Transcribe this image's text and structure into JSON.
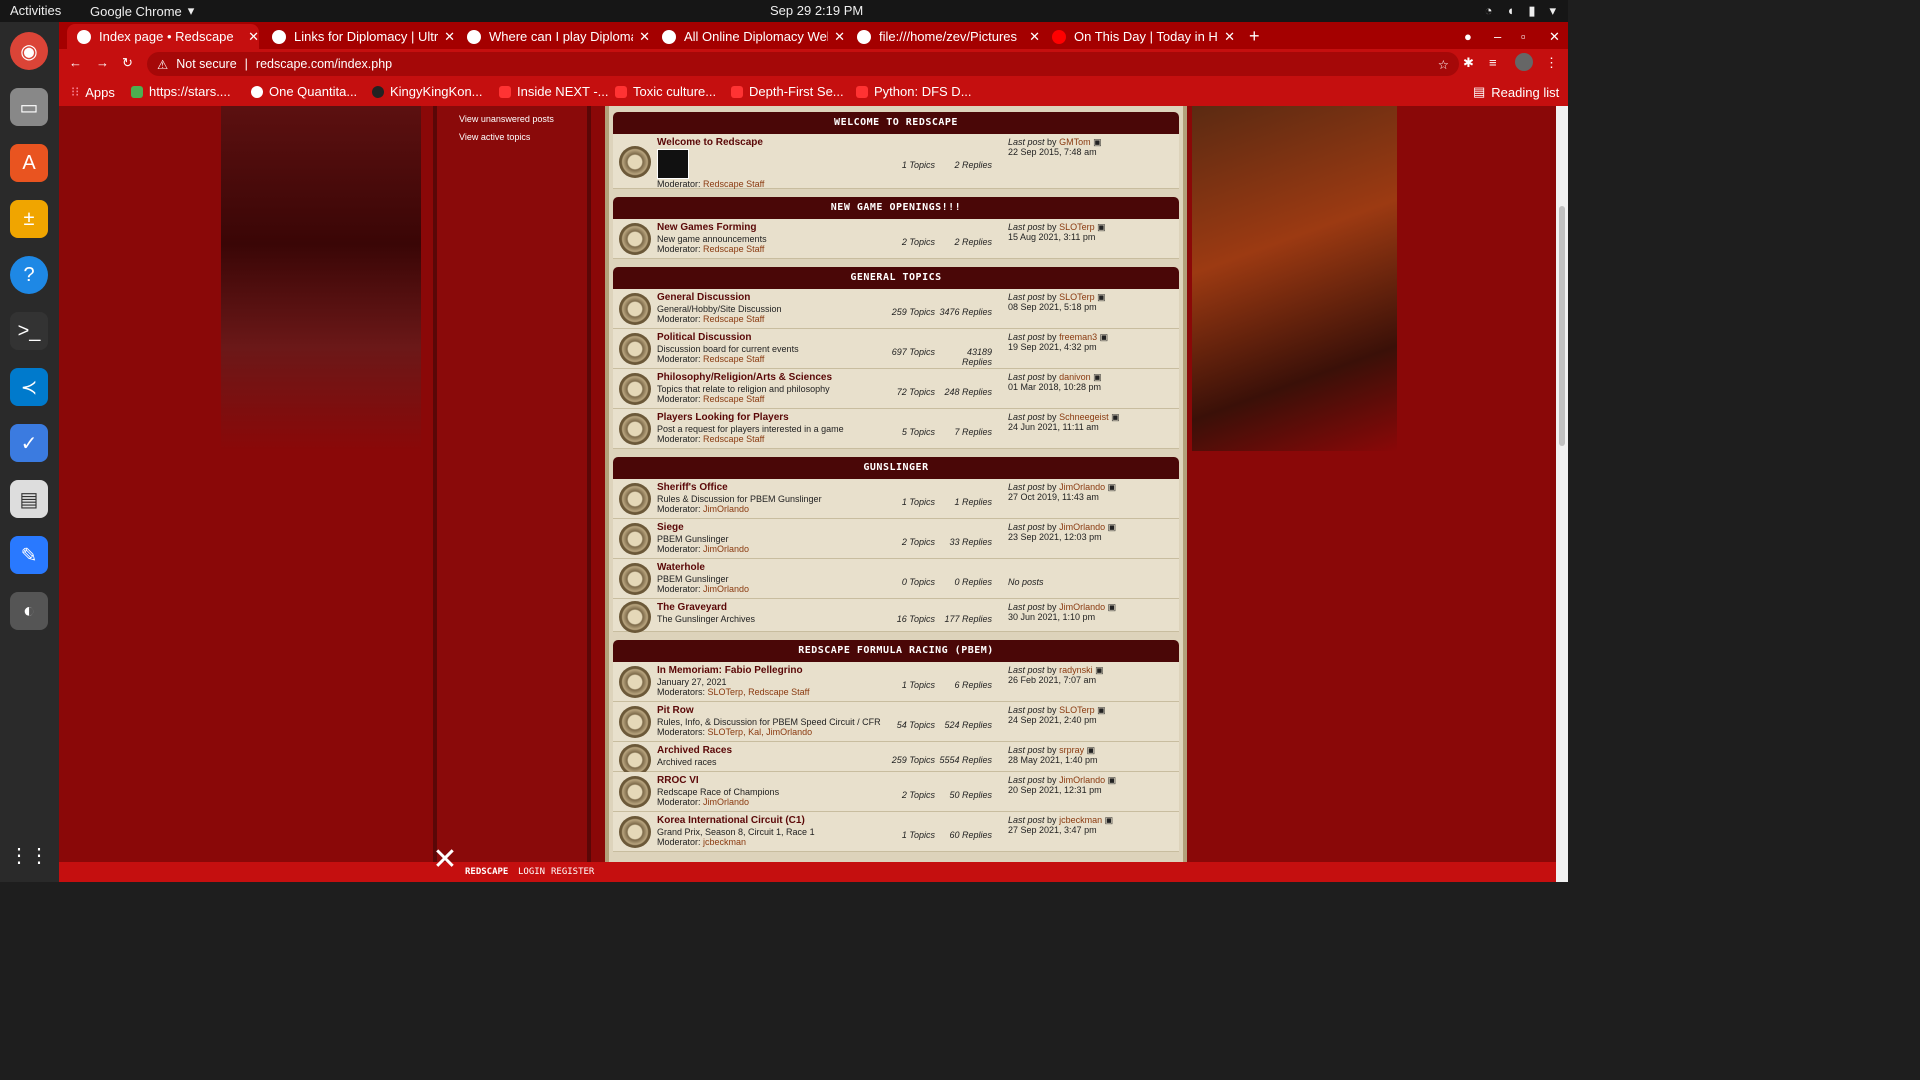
{
  "system": {
    "activities": "Activities",
    "app_name": "Google Chrome",
    "clock": "Sep 29  2:19 PM"
  },
  "tabs": [
    {
      "title": "Index page • Redscape"
    },
    {
      "title": "Links for Diplomacy | Ultr"
    },
    {
      "title": "Where can I play Diploma"
    },
    {
      "title": "All Online Diplomacy Web"
    },
    {
      "title": "file:///home/zev/Pictures"
    },
    {
      "title": "On This Day | Today in His"
    }
  ],
  "omnibox": {
    "security": "Not secure",
    "url": "redscape.com/index.php"
  },
  "bookmarks": {
    "apps": "Apps",
    "items": [
      "https://stars....",
      "One Quantita...",
      "KingyKingKon...",
      "Inside NEXT -...",
      "Toxic culture...",
      "Depth-First Se...",
      "Python: DFS D..."
    ],
    "reading_list": "Reading list"
  },
  "sidebar": {
    "links": [
      "View unanswered posts",
      "View active topics"
    ]
  },
  "categories": [
    {
      "title": "WELCOME TO REDSCAPE",
      "forums": [
        {
          "name": "Welcome to Redscape",
          "desc": "",
          "mod_label": "Moderator:",
          "mods": "Redscape Staff",
          "topics": "1 Topics",
          "replies": "2 Replies",
          "last_label": "Last post",
          "by": "by",
          "last_user": "GMTom",
          "last_date": "22 Sep 2015, 7:48 am"
        }
      ]
    },
    {
      "title": "NEW GAME OPENINGS!!!",
      "forums": [
        {
          "name": "New Games Forming",
          "desc": "New game announcements",
          "mod_label": "Moderator:",
          "mods": "Redscape Staff",
          "topics": "2 Topics",
          "replies": "2 Replies",
          "last_label": "Last post",
          "by": "by",
          "last_user": "SLOTerp",
          "last_date": "15 Aug 2021, 3:11 pm"
        }
      ]
    },
    {
      "title": "GENERAL TOPICS",
      "forums": [
        {
          "name": "General Discussion",
          "desc": "General/Hobby/Site Discussion",
          "mod_label": "Moderator:",
          "mods": "Redscape Staff",
          "topics": "259 Topics",
          "replies": "3476 Replies",
          "last_label": "Last post",
          "by": "by",
          "last_user": "SLOTerp",
          "last_date": "08 Sep 2021, 5:18 pm"
        },
        {
          "name": "Political Discussion",
          "desc": "Discussion board for current events",
          "mod_label": "Moderator:",
          "mods": "Redscape Staff",
          "topics": "697 Topics",
          "replies": "43189 Replies",
          "last_label": "Last post",
          "by": "by",
          "last_user": "freeman3",
          "last_date": "19 Sep 2021, 4:32 pm"
        },
        {
          "name": "Philosophy/Religion/Arts & Sciences",
          "desc": "Topics that relate to religion and philosophy",
          "mod_label": "Moderator:",
          "mods": "Redscape Staff",
          "topics": "72 Topics",
          "replies": "248 Replies",
          "last_label": "Last post",
          "by": "by",
          "last_user": "danivon",
          "last_date": "01 Mar 2018, 10:28 pm"
        },
        {
          "name": "Players Looking for Players",
          "desc": "Post a request for players interested in a game",
          "mod_label": "Moderator:",
          "mods": "Redscape Staff",
          "topics": "5 Topics",
          "replies": "7 Replies",
          "last_label": "Last post",
          "by": "by",
          "last_user": "Schneegeist",
          "last_date": "24 Jun 2021, 11:11 am"
        }
      ]
    },
    {
      "title": "GUNSLINGER",
      "forums": [
        {
          "name": "Sheriff's Office",
          "desc": "Rules & Discussion for PBEM Gunslinger",
          "mod_label": "Moderator:",
          "mods": "JimOrlando",
          "topics": "1 Topics",
          "replies": "1 Replies",
          "last_label": "Last post",
          "by": "by",
          "last_user": "JimOrlando",
          "last_date": "27 Oct 2019, 11:43 am"
        },
        {
          "name": "Siege",
          "desc": "PBEM Gunslinger",
          "mod_label": "Moderator:",
          "mods": "JimOrlando",
          "topics": "2 Topics",
          "replies": "33 Replies",
          "last_label": "Last post",
          "by": "by",
          "last_user": "JimOrlando",
          "last_date": "23 Sep 2021, 12:03 pm"
        },
        {
          "name": "Waterhole",
          "desc": "PBEM Gunslinger",
          "mod_label": "Moderator:",
          "mods": "JimOrlando",
          "topics": "0 Topics",
          "replies": "0 Replies",
          "last_label": "No posts",
          "by": "",
          "last_user": "",
          "last_date": ""
        },
        {
          "name": "The Graveyard",
          "desc": "The Gunslinger Archives",
          "mod_label": "",
          "mods": "",
          "topics": "16 Topics",
          "replies": "177 Replies",
          "last_label": "Last post",
          "by": "by",
          "last_user": "JimOrlando",
          "last_date": "30 Jun 2021, 1:10 pm"
        }
      ]
    },
    {
      "title": "REDSCAPE FORMULA RACING (PBEM)",
      "forums": [
        {
          "name": "In Memoriam: Fabio Pellegrino",
          "desc": "January 27, 2021",
          "mod_label": "Moderators:",
          "mods": "SLOTerp, Redscape Staff",
          "topics": "1 Topics",
          "replies": "6 Replies",
          "last_label": "Last post",
          "by": "by",
          "last_user": "radynski",
          "last_date": "26 Feb 2021, 7:07 am"
        },
        {
          "name": "Pit Row",
          "desc": "Rules, Info, & Discussion for PBEM Speed Circuit / CFR",
          "mod_label": "Moderators:",
          "mods": "SLOTerp, Kal, JimOrlando",
          "topics": "54 Topics",
          "replies": "524 Replies",
          "last_label": "Last post",
          "by": "by",
          "last_user": "SLOTerp",
          "last_date": "24 Sep 2021, 2:40 pm"
        },
        {
          "name": "Archived Races",
          "desc": "Archived races",
          "mod_label": "",
          "mods": "",
          "topics": "259 Topics",
          "replies": "5554 Replies",
          "last_label": "Last post",
          "by": "by",
          "last_user": "srpray",
          "last_date": "28 May 2021, 1:40 pm"
        },
        {
          "name": "RROC VI",
          "desc": "Redscape Race of Champions",
          "mod_label": "Moderator:",
          "mods": "JimOrlando",
          "topics": "2 Topics",
          "replies": "50 Replies",
          "last_label": "Last post",
          "by": "by",
          "last_user": "JimOrlando",
          "last_date": "20 Sep 2021, 12:31 pm"
        },
        {
          "name": "Korea International Circuit (C1)",
          "desc": "Grand Prix, Season 8, Circuit 1, Race 1",
          "mod_label": "Moderator:",
          "mods": "jcbeckman",
          "topics": "1 Topics",
          "replies": "60 Replies",
          "last_label": "Last post",
          "by": "by",
          "last_user": "jcbeckman",
          "last_date": "27 Sep 2021, 3:47 pm"
        }
      ]
    }
  ],
  "footer": {
    "brand": "REDSCAPE",
    "login": "LOGIN",
    "register": "REGISTER"
  }
}
